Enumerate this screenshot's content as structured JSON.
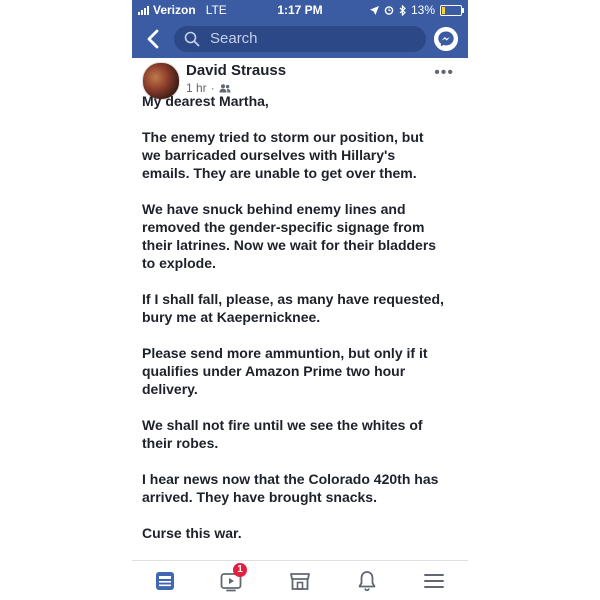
{
  "status_bar": {
    "carrier": "Verizon",
    "network": "LTE",
    "time": "1:17 PM",
    "battery": "13%",
    "battery_level": 0.13
  },
  "nav": {
    "search_placeholder": "Search"
  },
  "post": {
    "author": "David Strauss",
    "time": "1 hr",
    "separator": "·",
    "more_label": "•••",
    "paragraphs": [
      "My dearest Martha,",
      "The enemy tried to storm our position, but\nwe barricaded ourselves with Hillary's\nemails.  They are unable to get over them.",
      "We have snuck behind enemy lines and\nremoved the gender-specific signage from\ntheir latrines. Now we wait for their bladders\nto explode.",
      "If I shall fall, please, as many have requested,\nbury me at Kaepernicknee.",
      "Please send more ammuntion, but only if it\nqualifies under Amazon Prime two hour\ndelivery.",
      "We shall not fire until we see the whites of\ntheir robes.",
      "I hear news now that the Colorado 420th has\narrived.  They have brought snacks.",
      "Curse this war."
    ]
  },
  "tab_bar": {
    "video_badge": "1",
    "icons": [
      "news-feed-icon",
      "watch-icon",
      "marketplace-icon",
      "notifications-icon",
      "menu-icon"
    ]
  },
  "colors": {
    "brand": "#3b5ba3",
    "badge": "#e41e3f",
    "active_tab": "#4267b2"
  }
}
